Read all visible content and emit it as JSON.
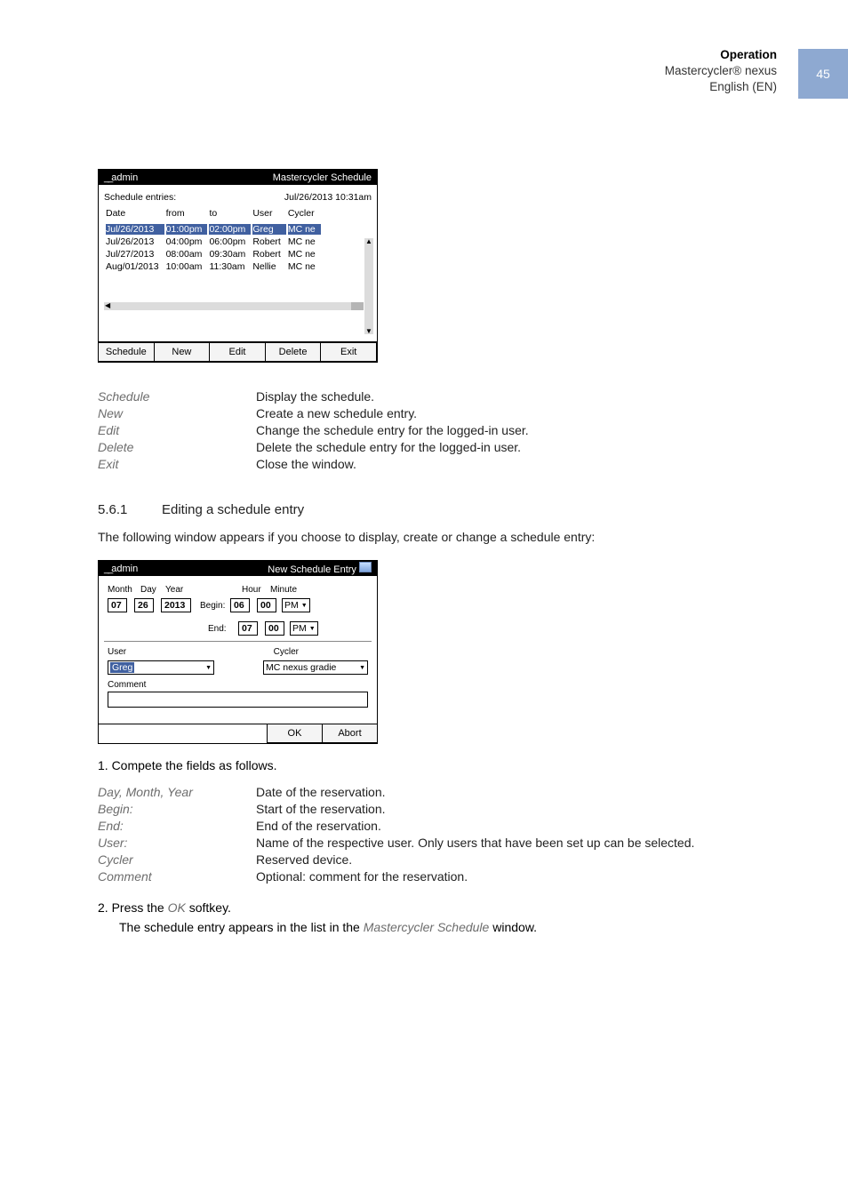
{
  "page_number": "45",
  "header": {
    "section": "Operation",
    "product": "Mastercycler® nexus",
    "language": "English (EN)"
  },
  "shot1": {
    "user": "admin",
    "title": "Mastercycler Schedule",
    "entries_label": "Schedule entries:",
    "datetime": "Jul/26/2013 10:31am",
    "cols": {
      "date": "Date",
      "from": "from",
      "to": "to",
      "user": "User",
      "cycler": "Cycler"
    },
    "rows": [
      {
        "date": "Jul/26/2013",
        "from": "01:00pm",
        "to": "02:00pm",
        "user": "Greg",
        "cycler": "MC ne"
      },
      {
        "date": "Jul/26/2013",
        "from": "04:00pm",
        "to": "06:00pm",
        "user": "Robert",
        "cycler": "MC ne"
      },
      {
        "date": "Jul/27/2013",
        "from": "08:00am",
        "to": "09:30am",
        "user": "Robert",
        "cycler": "MC ne"
      },
      {
        "date": "Aug/01/2013",
        "from": "10:00am",
        "to": "11:30am",
        "user": "Nellie",
        "cycler": "MC ne"
      }
    ],
    "keys": {
      "schedule": "Schedule",
      "new": "New",
      "edit": "Edit",
      "delete": "Delete",
      "exit": "Exit"
    }
  },
  "defs1": [
    {
      "term": "Schedule",
      "desc": "Display the schedule."
    },
    {
      "term": "New",
      "desc": "Create a new schedule entry."
    },
    {
      "term": "Edit",
      "desc": "Change the schedule entry for the logged-in user."
    },
    {
      "term": "Delete",
      "desc": "Delete the schedule entry for the logged-in user."
    },
    {
      "term": "Exit",
      "desc": "Close the window."
    }
  ],
  "section": {
    "num": "5.6.1",
    "title": "Editing a schedule entry"
  },
  "intro": "The following window appears if you choose to display, create or change a schedule entry:",
  "shot2": {
    "user": "admin",
    "title": "New Schedule Entry",
    "labels": {
      "month": "Month",
      "day": "Day",
      "year": "Year",
      "hour": "Hour",
      "minute": "Minute",
      "begin": "Begin:",
      "end": "End:",
      "user": "User",
      "cycler": "Cycler",
      "comment": "Comment"
    },
    "vals": {
      "month": "07",
      "day": "26",
      "year": "2013",
      "begHour": "06",
      "begMin": "00",
      "begAmPm": "PM",
      "endHour": "07",
      "endMin": "00",
      "endAmPm": "PM",
      "userSel": "Greg",
      "cyclerSel": "MC nexus gradie"
    },
    "keys": {
      "ok": "OK",
      "abort": "Abort"
    }
  },
  "step1": "1.  Compete the fields as follows.",
  "defs2": [
    {
      "term": "Day, Month, Year",
      "desc": "Date of the reservation."
    },
    {
      "term": "Begin:",
      "desc": "Start of the reservation."
    },
    {
      "term": "End:",
      "desc": "End of the reservation."
    },
    {
      "term": "User:",
      "desc": "Name of the respective user. Only users that have been set up can be selected."
    },
    {
      "term": "Cycler",
      "desc": "Reserved device."
    },
    {
      "term": "Comment",
      "desc": "Optional: comment for the reservation."
    }
  ],
  "step2_pre": "2.  Press the ",
  "step2_em": "OK",
  "step2_post": " softkey.",
  "step2_res_a": "The schedule entry appears in the list in the ",
  "step2_res_em": "Mastercycler Schedule",
  "step2_res_b": " window."
}
